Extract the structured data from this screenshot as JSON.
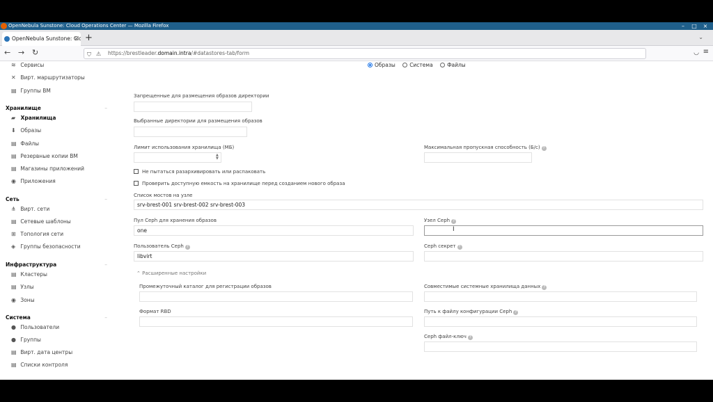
{
  "window": {
    "title": "OpenNebula Sunstone: Cloud Operations Center — Mozilla Firefox",
    "minimize": "–",
    "maximize": "□",
    "close": "×"
  },
  "browser": {
    "tab_title": "OpenNebula Sunstone: Clo",
    "tab_close": "×",
    "new_tab": "+",
    "tab_list": "⌄",
    "back": "←",
    "forward": "→",
    "reload": "↻",
    "url_prefix": "https://brestleader.",
    "url_host": "domain.intra",
    "url_suffix": "/#datastores-tab/form",
    "menu": "≡"
  },
  "sidebar": {
    "items_top": [
      {
        "label": "Сервисы",
        "icon": "≋"
      },
      {
        "label": "Вирт. маршрутизаторы",
        "icon": "✕"
      },
      {
        "label": "Группы ВМ",
        "icon": "▤"
      }
    ],
    "groups": [
      {
        "title": "Хранилище",
        "caret": "–",
        "items": [
          {
            "label": "Хранилища",
            "icon": "▰",
            "active": true
          },
          {
            "label": "Образы",
            "icon": "⬇"
          },
          {
            "label": "Файлы",
            "icon": "▤"
          },
          {
            "label": "Резервные копии ВМ",
            "icon": "▤"
          },
          {
            "label": "Магазины приложений",
            "icon": "▤"
          },
          {
            "label": "Приложения",
            "icon": "◉"
          }
        ]
      },
      {
        "title": "Сеть",
        "caret": "–",
        "items": [
          {
            "label": "Вирт. сети",
            "icon": "⋔"
          },
          {
            "label": "Сетевые шаблоны",
            "icon": "▤"
          },
          {
            "label": "Топология сети",
            "icon": "⊞"
          },
          {
            "label": "Группы безопасности",
            "icon": "◈"
          }
        ]
      },
      {
        "title": "Инфраструктура",
        "caret": "–",
        "items": [
          {
            "label": "Кластеры",
            "icon": "▤"
          },
          {
            "label": "Узлы",
            "icon": "▤"
          },
          {
            "label": "Зоны",
            "icon": "◉"
          }
        ]
      },
      {
        "title": "Система",
        "caret": "–",
        "items": [
          {
            "label": "Пользователи",
            "icon": "●"
          },
          {
            "label": "Группы",
            "icon": "●"
          },
          {
            "label": "Вирт. дата центры",
            "icon": "▤"
          },
          {
            "label": "Списки контроля",
            "icon": "▤"
          }
        ]
      }
    ]
  },
  "form": {
    "type_options": [
      {
        "label": "Образы",
        "selected": true
      },
      {
        "label": "Система",
        "selected": false
      },
      {
        "label": "Файлы",
        "selected": false
      }
    ],
    "restricted_dirs_label": "Запрещенные для размещения образов директории",
    "safe_dirs_label": "Выбранные директории для размещения образов",
    "limit_mb_label": "Лимит использования хранилища (МБ)",
    "max_bandwidth_label": "Максимальная пропускная способность (Б/с)",
    "no_decompress_label": "Не пытаться разархивировать или распаковать",
    "check_capacity_label": "Проверить доступную емкость на хранилище перед созданием нового образа",
    "bridge_list_label": "Список мостов на узле",
    "bridge_list_value": "srv-brest-001 srv-brest-002 srv-brest-003",
    "ceph_pool_label": "Пул Ceph для хранения образов",
    "ceph_pool_value": "one",
    "ceph_host_label": "Узел Ceph",
    "ceph_host_value": "",
    "ceph_user_label": "Пользователь Ceph",
    "ceph_user_value": "libvirt",
    "ceph_secret_label": "Ceph секрет",
    "ceph_secret_value": "",
    "advanced_label": "Расширенные настройки",
    "staging_dir_label": "Промежуточный каталог для регистрации образов",
    "compatible_ds_label": "Совместимые системные хранилища данных",
    "rbd_format_label": "Формат RBD",
    "ceph_conf_label": "Путь к файлу конфигурации Ceph",
    "ceph_key_label": "Ceph файл-ключ",
    "hint_glyph": "?"
  }
}
